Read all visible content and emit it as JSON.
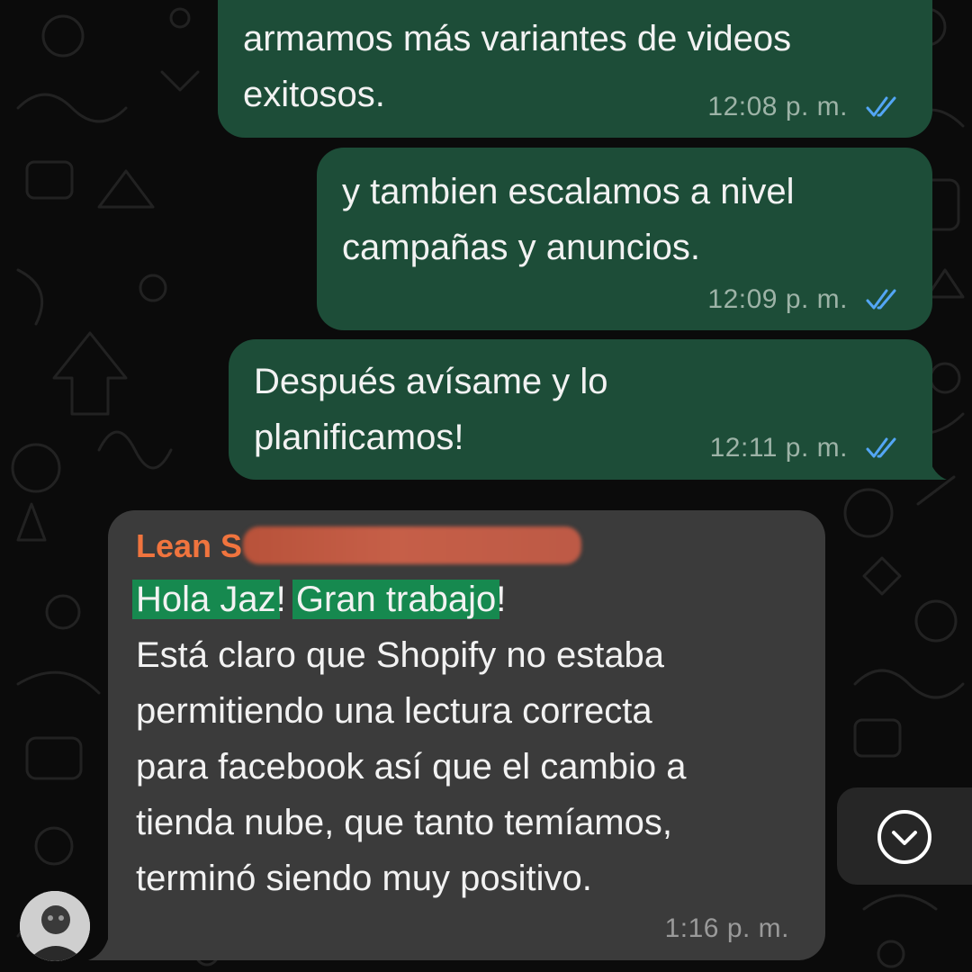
{
  "colors": {
    "outgoing_bubble": "#1d4d38",
    "incoming_bubble": "#3b3b3b",
    "read_ticks": "#53a6f5",
    "sender_name": "#f0743e",
    "highlight": "#16894f"
  },
  "messages": [
    {
      "direction": "outgoing",
      "lines": [
        "armamos más variantes de videos",
        "exitosos."
      ],
      "time": "12:08 p. m.",
      "status_icon": "double-check-read-icon"
    },
    {
      "direction": "outgoing",
      "lines": [
        "y tambien escalamos a nivel",
        "campañas y anuncios."
      ],
      "time": "12:09 p. m.",
      "status_icon": "double-check-read-icon"
    },
    {
      "direction": "outgoing",
      "lines": [
        "Después avísame y lo",
        "planificamos!"
      ],
      "time": "12:11 p. m.",
      "status_icon": "double-check-read-icon"
    },
    {
      "direction": "incoming",
      "sender": "Lean S",
      "highlighted": [
        "Hola Jaz",
        "Gran trabajo"
      ],
      "first_line_punct": [
        "!",
        "!"
      ],
      "lines": [
        "Está claro que Shopify no estaba",
        "permitiendo una lectura correcta",
        "para facebook así que el cambio a",
        "tienda nube, que tanto temíamos,",
        "terminó siendo muy positivo."
      ],
      "time": "1:16 p. m."
    }
  ],
  "scroll_button_icon": "chevron-down-circle-icon",
  "avatar_icon": "avatar"
}
